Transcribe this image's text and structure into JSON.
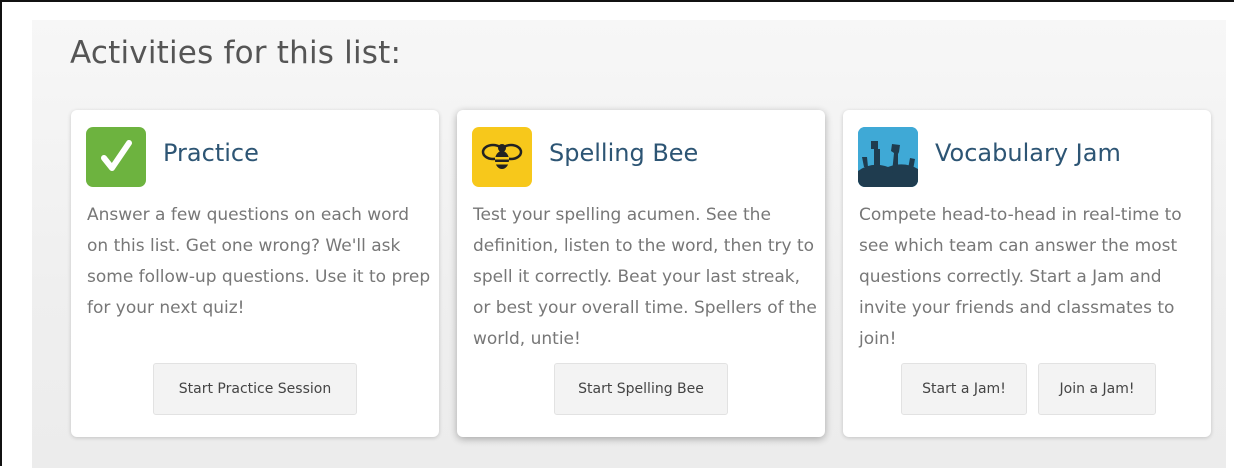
{
  "heading": "Activities for this list:",
  "cards": [
    {
      "title": "Practice",
      "icon": "checkmark-icon",
      "icon_color": "#6db33f",
      "description": "Answer a few questions on each word on this list. Get one wrong? We'll ask some follow-up questions. Use it to prep for your next quiz!",
      "buttons": [
        "Start Practice Session"
      ]
    },
    {
      "title": "Spelling Bee",
      "icon": "bee-icon",
      "icon_color": "#f7c81b",
      "description": "Test your spelling acumen. See the definition, listen to the word, then try to spell it correctly. Beat your last streak, or best your overall time. Spellers of the world, untie!",
      "buttons": [
        "Start Spelling Bee"
      ]
    },
    {
      "title": "Vocabulary Jam",
      "icon": "jam-hands-icon",
      "icon_color": "#3fa9d6",
      "description": "Compete head-to-head in real-time to see which team can answer the most questions correctly. Start a Jam and invite your friends and classmates to join!",
      "buttons": [
        "Start a Jam!",
        "Join a Jam!"
      ]
    }
  ]
}
